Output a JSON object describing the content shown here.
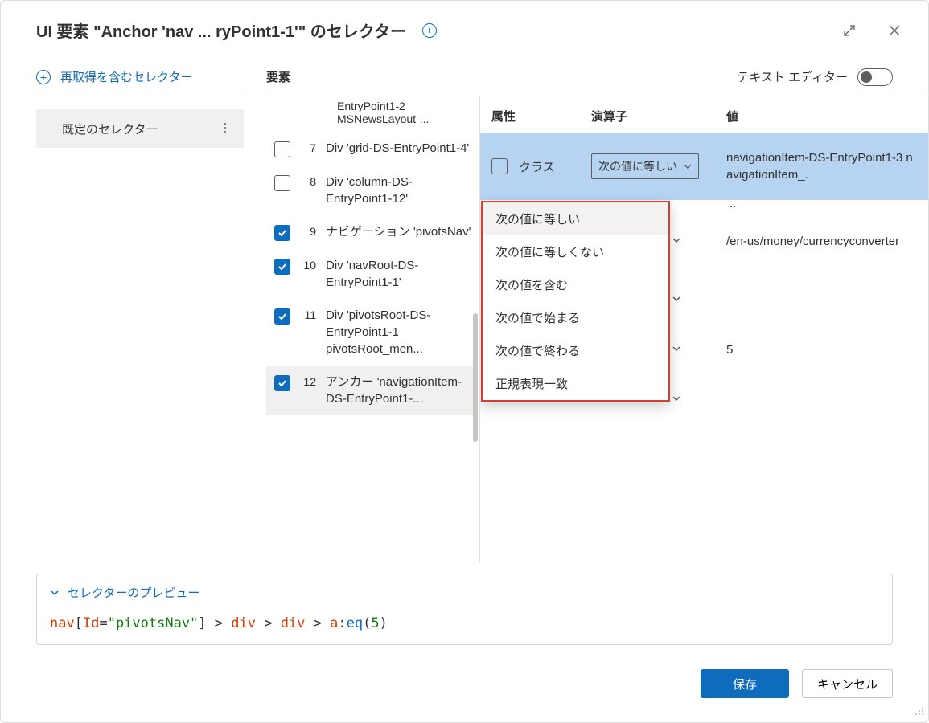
{
  "header": {
    "title": "UI 要素 \"Anchor 'nav ... ryPoint1-1'\" のセレクター"
  },
  "left": {
    "add_selector": "再取得を含むセレクター",
    "default_selector": "既定のセレクター"
  },
  "top": {
    "elements": "要素",
    "text_editor": "テキスト エディター"
  },
  "partial_item": "EntryPoint1-2 MSNewsLayout-...",
  "elements": [
    {
      "idx": "7",
      "checked": false,
      "label": "Div 'grid-DS-EntryPoint1-4'"
    },
    {
      "idx": "8",
      "checked": false,
      "label": "Div 'column-DS-EntryPoint1-12'"
    },
    {
      "idx": "9",
      "checked": true,
      "label": "ナビゲーション 'pivotsNav'"
    },
    {
      "idx": "10",
      "checked": true,
      "label": "Div 'navRoot-DS-EntryPoint1-1'"
    },
    {
      "idx": "11",
      "checked": true,
      "label": "Div 'pivotsRoot-DS-EntryPoint1-1 pivotsRoot_men..."
    },
    {
      "idx": "12",
      "checked": true,
      "label": "アンカー 'navigationItem-DS-EntryPoint1-...",
      "selected": true
    }
  ],
  "attr": {
    "headers": {
      "attr": "属性",
      "op": "演算子",
      "val": "値"
    },
    "rows": [
      {
        "name": "クラス",
        "op": "次の値に等しい",
        "val": "navigationItem-DS-EntryPoint1-3 navigationItem_.",
        "hl": true,
        "boxed": true
      },
      {
        "name": "",
        "val": "/en-us/money/currencyconverter"
      },
      {
        "name": "",
        "val": ""
      },
      {
        "name": "",
        "val": "5"
      },
      {
        "name": "",
        "val": ""
      }
    ],
    "stray": "..",
    "dropdown": [
      "次の値に等しい",
      "次の値に等しくない",
      "次の値を含む",
      "次の値で始まる",
      "次の値で終わる",
      "正規表現一致"
    ]
  },
  "preview": {
    "label": "セレクターのプレビュー",
    "code": {
      "p1": "nav",
      "p2": "[",
      "p3": "Id",
      "p4": "=",
      "p5": "\"pivotsNav\"",
      "p6": "] > ",
      "p7": "div",
      "p8": " > ",
      "p9": "div",
      "p10": " > ",
      "p11": "a",
      "p12": ":",
      "p13": "eq",
      "p14": "(",
      "p15": "5",
      "p16": ")"
    }
  },
  "footer": {
    "save": "保存",
    "cancel": "キャンセル"
  }
}
